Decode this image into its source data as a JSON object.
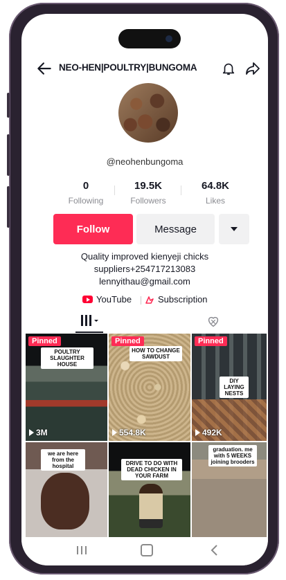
{
  "header": {
    "title": "NEO-HEN|POULTRY|BUNGOMA",
    "back_icon": "arrow-left-icon",
    "bell_icon": "bell-icon",
    "share_icon": "share-arrow-icon"
  },
  "profile": {
    "handle": "@neohenbungoma",
    "stats": [
      {
        "value": "0",
        "label": "Following"
      },
      {
        "value": "19.5K",
        "label": "Followers"
      },
      {
        "value": "64.8K",
        "label": "Likes"
      }
    ],
    "follow_label": "Follow",
    "message_label": "Message",
    "bio_lines": [
      "Quality improved kienyeji chicks",
      "suppliers+254717213083",
      "lennyithau@gmail.com"
    ],
    "links": {
      "youtube": "YouTube",
      "subscription": "Subscription"
    }
  },
  "videos": [
    {
      "pinned": "Pinned",
      "caption": "POULTRY SLAUGHTER HOUSE",
      "views": "3M"
    },
    {
      "pinned": "Pinned",
      "caption": "HOW TO CHANGE SAWDUST",
      "views": "554.8K"
    },
    {
      "pinned": "Pinned",
      "caption": "DIY LAYING NESTS",
      "views": "492K"
    },
    {
      "caption": "we are here from the hospital",
      "views": ""
    },
    {
      "caption": "DRIVE TO DO WITH DEAD CHICKEN IN YOUR FARM",
      "views": ""
    },
    {
      "caption": "graduation. me with 5 WEEKS joining brooders",
      "views": ""
    }
  ],
  "colors": {
    "accent": "#fe2c55",
    "text": "#161823",
    "muted": "#8a8b91",
    "secondary_button": "#f1f1f2"
  }
}
